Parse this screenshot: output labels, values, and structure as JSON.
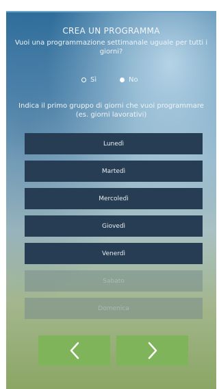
{
  "title": "CREA UN PROGRAMMA",
  "question": "Vuoi una programmazione settimanale uguale per tutti i giorni?",
  "radio": {
    "yes_label": "Sì",
    "no_label": "No",
    "selected": "No"
  },
  "instruction": "Indica il primo gruppo di giorni che vuoi programmare (es. giorni lavorativi)",
  "days": [
    {
      "label": "Lunedì",
      "enabled": true
    },
    {
      "label": "Martedì",
      "enabled": true
    },
    {
      "label": "Mercoledì",
      "enabled": true
    },
    {
      "label": "Giovedì",
      "enabled": true
    },
    {
      "label": "Venerdì",
      "enabled": true
    },
    {
      "label": "Sabato",
      "enabled": false
    },
    {
      "label": "Domenica",
      "enabled": false
    }
  ],
  "nav": {
    "back_icon": "chevron-left-icon",
    "next_icon": "chevron-right-icon"
  },
  "colors": {
    "day_button": "#263d54",
    "nav_button": "#7fb45a"
  }
}
